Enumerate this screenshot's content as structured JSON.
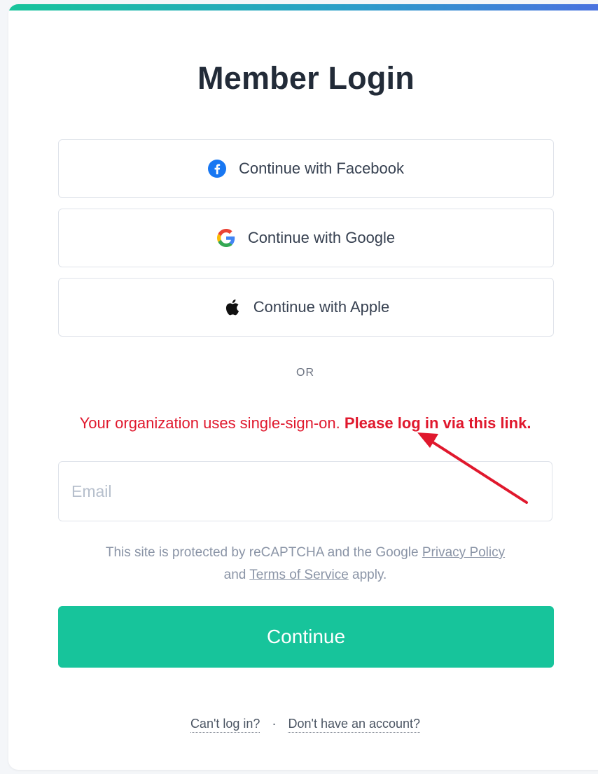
{
  "login": {
    "title": "Member Login",
    "facebook_label": "Continue with Facebook",
    "google_label": "Continue with Google",
    "apple_label": "Continue with Apple",
    "or_label": "OR",
    "sso_message": "Your organization uses single-sign-on.",
    "sso_link": "Please log in via this link.",
    "email_placeholder": "Email",
    "recaptcha_prefix": "This site is protected by reCAPTCHA and the Google",
    "privacy_link": "Privacy Policy",
    "recaptcha_and": "and",
    "terms_link": "Terms of Service",
    "recaptcha_suffix": "apply.",
    "continue_label": "Continue",
    "cant_login_link": "Can't log in?",
    "separator": "·",
    "no_account_link": "Don't have an account?"
  },
  "icons": {
    "facebook": "facebook-icon",
    "google": "google-icon",
    "apple": "apple-icon",
    "annotation": "red-arrow-annotation"
  },
  "colors": {
    "accent": "#17c49b",
    "error": "#e0182d",
    "facebook": "#1877f2",
    "annotation": "#e0182d"
  }
}
